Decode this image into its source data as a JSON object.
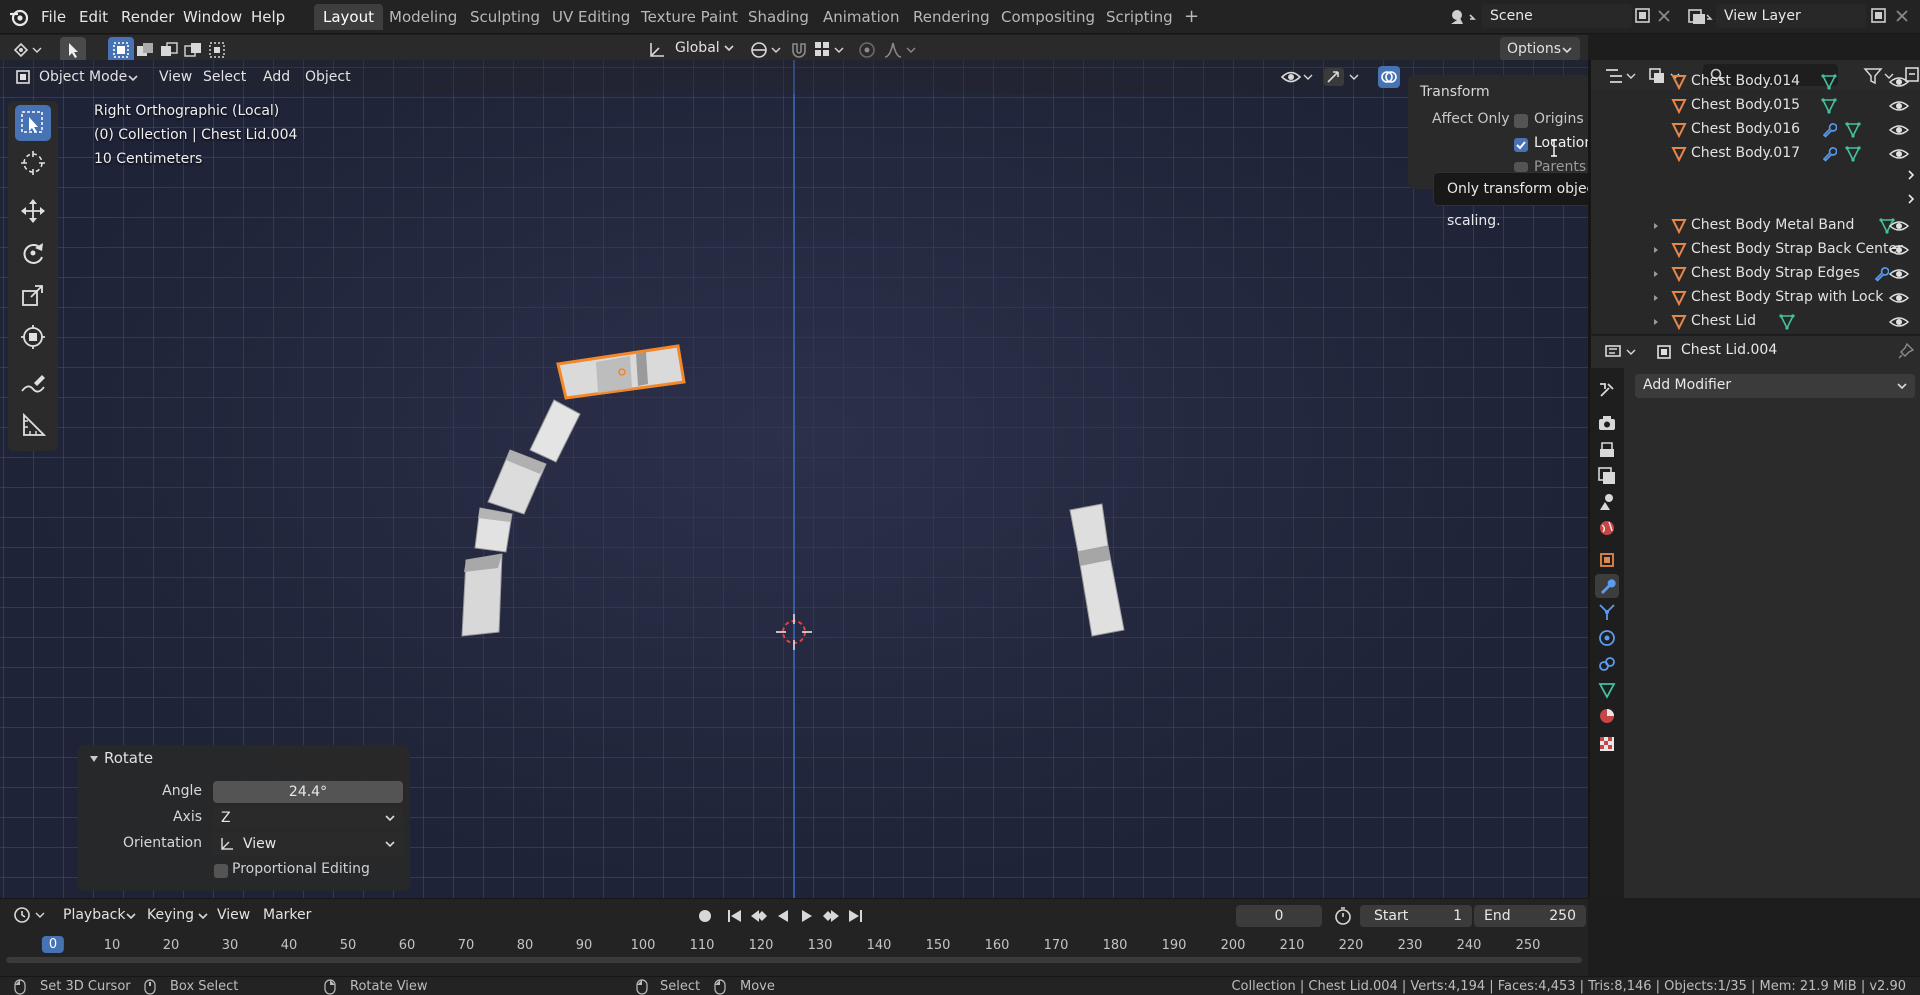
{
  "topbar": {
    "menus": [
      "File",
      "Edit",
      "Render",
      "Window",
      "Help"
    ],
    "workspaces": [
      "Layout",
      "Modeling",
      "Sculpting",
      "UV Editing",
      "Texture Paint",
      "Shading",
      "Animation",
      "Rendering",
      "Compositing",
      "Scripting"
    ],
    "active_workspace": "Layout",
    "add_workspace": "+",
    "scene": "Scene",
    "view_layer": "View Layer"
  },
  "header": {
    "orientation": "Global",
    "options": "Options",
    "mode": "Object Mode",
    "menus": [
      "View",
      "Select",
      "Add",
      "Object"
    ]
  },
  "viewport": {
    "view_name": "Right Orthographic (Local)",
    "collection_line": "(0) Collection | Chest Lid.004",
    "scale": "10 Centimeters"
  },
  "transform_popover": {
    "title": "Transform",
    "affect_only": "Affect Only",
    "origins": "Origins",
    "origins_checked": false,
    "locations": "Locations",
    "locations_checked": true,
    "parents": "Parents"
  },
  "tooltip": "Only transform object locations, without affecting rotation or scaling.",
  "outliner": {
    "items": [
      {
        "label": "Chest Body.014",
        "icons": [
          "mesh-data"
        ]
      },
      {
        "label": "Chest Body.015",
        "icons": [
          "mesh-data"
        ]
      },
      {
        "label": "Chest Body.016",
        "icons": [
          "modifier",
          "mesh-data"
        ]
      },
      {
        "label": "Chest Body.017",
        "icons": [
          "modifier",
          "mesh-data"
        ]
      },
      {
        "label": "Chest Body Metal Band",
        "icons": [
          "mesh-data"
        ]
      },
      {
        "label": "Chest Body Strap Back Center",
        "icons": []
      },
      {
        "label": "Chest Body Strap Edges",
        "icons": [
          "modifier"
        ]
      },
      {
        "label": "Chest Body Strap with Lock",
        "icons": []
      },
      {
        "label": "Chest Lid",
        "icons": [
          "mesh-data"
        ]
      }
    ]
  },
  "properties": {
    "object_name": "Chest Lid.004",
    "add_modifier": "Add Modifier",
    "active_tab": "modifiers"
  },
  "redo_panel": {
    "title": "Rotate",
    "angle_label": "Angle",
    "angle_value": "24.4°",
    "axis_label": "Axis",
    "axis_value": "Z",
    "orientation_label": "Orientation",
    "orientation_value": "View",
    "proportional_label": "Proportional Editing",
    "proportional_checked": false
  },
  "timeline": {
    "menus": [
      "Playback",
      "Keying",
      "View",
      "Marker"
    ],
    "current_frame": "0",
    "start_label": "Start",
    "start_value": "1",
    "end_label": "End",
    "end_value": "250",
    "ticks": [
      "0",
      "10",
      "20",
      "30",
      "40",
      "50",
      "60",
      "70",
      "80",
      "90",
      "100",
      "110",
      "120",
      "130",
      "140",
      "150",
      "160",
      "170",
      "180",
      "190",
      "200",
      "210",
      "220",
      "230",
      "240",
      "250"
    ]
  },
  "statusbar": {
    "hints": [
      "Set 3D Cursor",
      "Box Select",
      "Rotate View",
      "Select",
      "Move"
    ],
    "stats": "Collection | Chest Lid.004 | Verts:4,194 | Faces:4,453 | Tris:8,146 | Objects:1/35 | Mem: 21.9 MiB | v2.90"
  },
  "colors": {
    "accent": "#4772b3",
    "selected_outline": "#f5872b",
    "mesh_data_green": "#42c2a0",
    "object_orange": "#e3874a",
    "viewport_bg": "#1f2337"
  }
}
